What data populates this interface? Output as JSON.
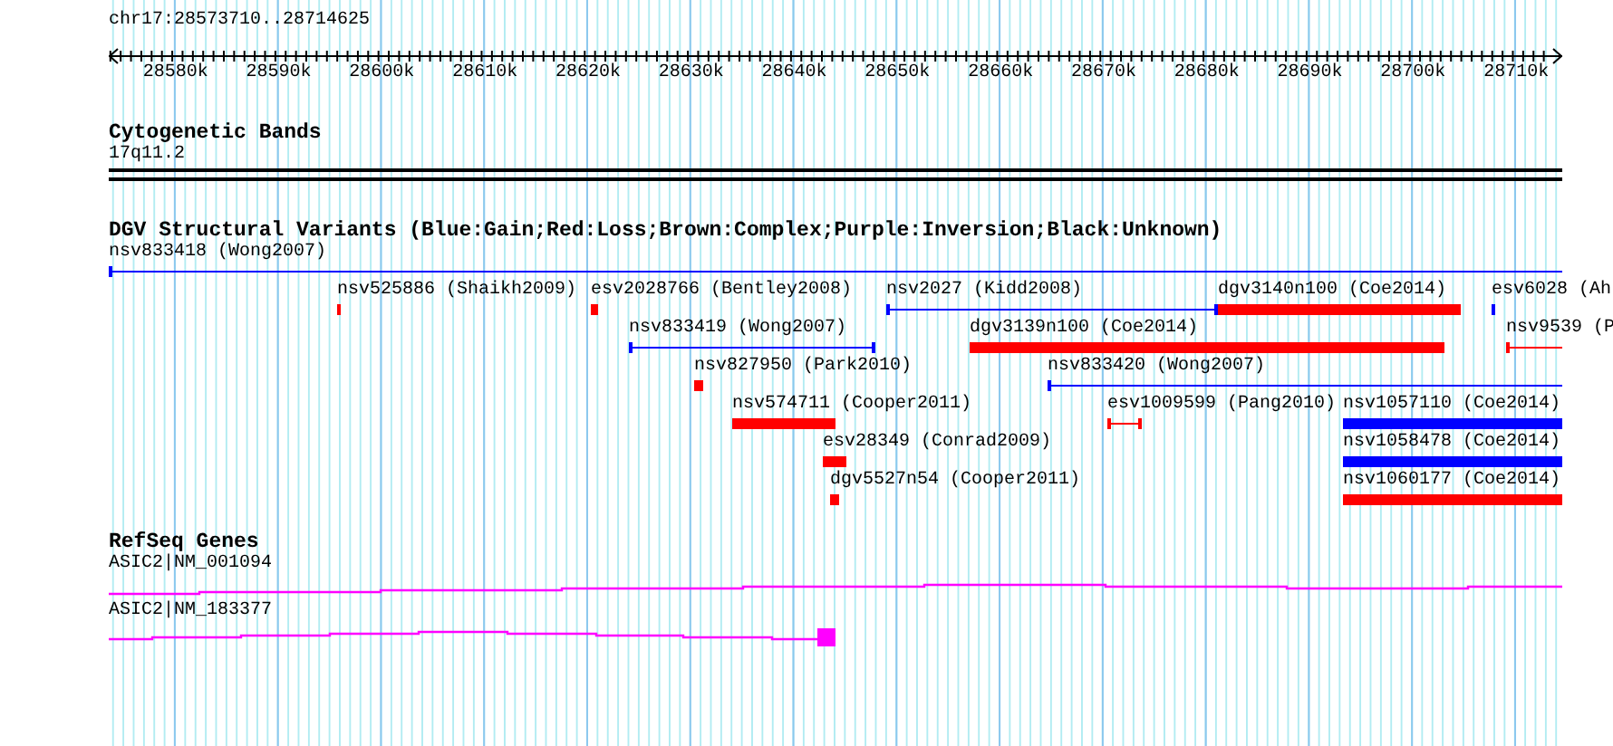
{
  "ruler": {
    "range": "chr17:28573710..28714625",
    "ticks": [
      "28580k",
      "28590k",
      "28600k",
      "28610k",
      "28620k",
      "28630k",
      "28640k",
      "28650k",
      "28660k",
      "28670k",
      "28680k",
      "28690k",
      "28700k",
      "28710k"
    ]
  },
  "cytoband_track": {
    "title": "Cytogenetic Bands",
    "band": "17q11.2"
  },
  "dgv_track": {
    "title": "DGV Structural Variants (Blue:Gain;Red:Loss;Brown:Complex;Purple:Inversion;Black:Unknown)",
    "rows": [
      {
        "features": [
          {
            "label": "nsv833418 (Wong2007)",
            "kind": "line",
            "color": "#0000ff"
          }
        ]
      },
      {
        "features": [
          {
            "label": "nsv525886 (Shaikh2009)",
            "kind": "bar",
            "color": "#ff0000"
          },
          {
            "label": "esv2028766 (Bentley2008)",
            "kind": "bar",
            "color": "#ff0000"
          },
          {
            "label": "nsv2027 (Kidd2008)",
            "kind": "line",
            "color": "#0000ff"
          },
          {
            "label": "dgv3140n100 (Coe2014)",
            "kind": "bar",
            "color": "#ff0000"
          },
          {
            "label": "esv6028 (Ah",
            "kind": "bar",
            "color": "#0000ff"
          }
        ]
      },
      {
        "features": [
          {
            "label": "nsv833419 (Wong2007)",
            "kind": "line",
            "color": "#0000ff"
          },
          {
            "label": "dgv3139n100 (Coe2014)",
            "kind": "bar",
            "color": "#ff0000"
          },
          {
            "label": "nsv9539 (P",
            "kind": "line",
            "color": "#ff0000"
          }
        ]
      },
      {
        "features": [
          {
            "label": "nsv827950 (Park2010)",
            "kind": "bar",
            "color": "#ff0000"
          },
          {
            "label": "nsv833420 (Wong2007)",
            "kind": "line",
            "color": "#0000ff"
          }
        ]
      },
      {
        "features": [
          {
            "label": "nsv574711 (Cooper2011)",
            "kind": "bar",
            "color": "#ff0000"
          },
          {
            "label": "esv1009599 (Pang2010)",
            "kind": "line",
            "color": "#ff0000"
          },
          {
            "label": "nsv1057110 (Coe2014)",
            "kind": "bar",
            "color": "#0000ff"
          }
        ]
      },
      {
        "features": [
          {
            "label": "esv28349 (Conrad2009)",
            "kind": "bar",
            "color": "#ff0000"
          },
          {
            "label": "nsv1058478 (Coe2014)",
            "kind": "bar",
            "color": "#0000ff"
          }
        ]
      },
      {
        "features": [
          {
            "label": "dgv5527n54 (Cooper2011)",
            "kind": "bar",
            "color": "#ff0000"
          },
          {
            "label": "nsv1060177 (Coe2014)",
            "kind": "bar",
            "color": "#ff0000"
          }
        ]
      }
    ]
  },
  "refseq_track": {
    "title": "RefSeq Genes",
    "genes": [
      {
        "label": "ASIC2|NM_001094"
      },
      {
        "label": "ASIC2|NM_183377"
      }
    ]
  }
}
